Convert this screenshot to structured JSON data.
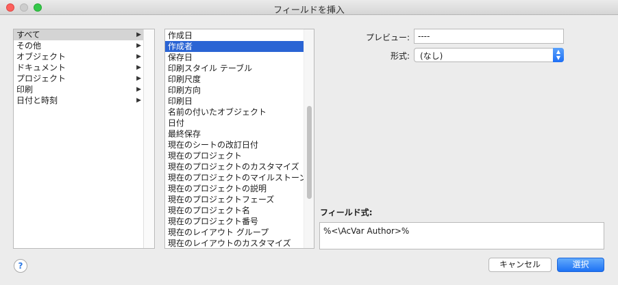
{
  "window": {
    "title": "フィールドを挿入"
  },
  "categories": [
    {
      "label": "すべて",
      "arrow": "▶"
    },
    {
      "label": "その他",
      "arrow": "▶"
    },
    {
      "label": "オブジェクト",
      "arrow": "▶"
    },
    {
      "label": "ドキュメント",
      "arrow": "▶"
    },
    {
      "label": "プロジェクト",
      "arrow": "▶"
    },
    {
      "label": "印刷",
      "arrow": "▶"
    },
    {
      "label": "日付と時刻",
      "arrow": "▶"
    }
  ],
  "fields": [
    "作成日",
    "作成者",
    "保存日",
    "印刷スタイル テーブル",
    "印刷尺度",
    "印刷方向",
    "印刷日",
    "名前の付いたオブジェクト",
    "日付",
    "最終保存",
    "現在のシートの改訂日付",
    "現在のプロジェクト",
    "現在のプロジェクトのカスタマイズ",
    "現在のプロジェクトのマイルストーン",
    "現在のプロジェクトの説明",
    "現在のプロジェクトフェーズ",
    "現在のプロジェクト名",
    "現在のプロジェクト番号",
    "現在のレイアウト グループ",
    "現在のレイアウトのカスタマイズ"
  ],
  "preview": {
    "label": "プレビュー:",
    "value": "----"
  },
  "format": {
    "label": "形式:",
    "value": "(なし)"
  },
  "formula": {
    "label": "フィールド式:",
    "value": "%<\\AcVar Author>%"
  },
  "help_label": "?",
  "buttons": {
    "cancel": "キャンセル",
    "select": "選択"
  },
  "colors": {
    "selection_blue": "#2a64d4",
    "default_button": "#1d71f4"
  }
}
